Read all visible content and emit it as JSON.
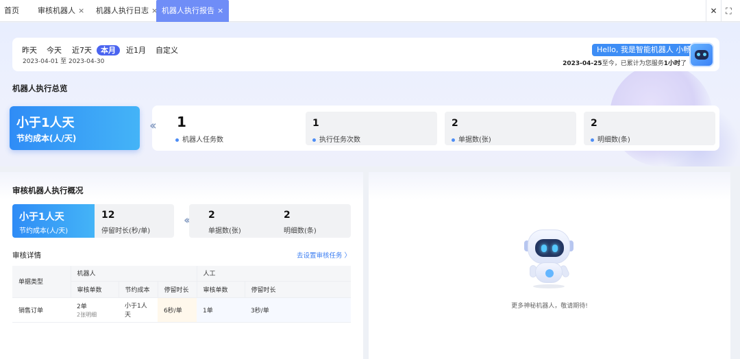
{
  "tabs": [
    {
      "label": "首页",
      "closable": false,
      "active": false
    },
    {
      "label": "审核机器人",
      "closable": true,
      "active": false
    },
    {
      "label": "机器人执行日志",
      "closable": true,
      "active": false
    },
    {
      "label": "机器人执行报告",
      "closable": true,
      "active": true
    }
  ],
  "tab_close_glyph": "×",
  "window_controls": {
    "close": "✕",
    "fullscreen": "⛶"
  },
  "date_filter": {
    "options": [
      "昨天",
      "今天",
      "近7天",
      "本月",
      "近1月",
      "自定义"
    ],
    "selected": "本月",
    "range": "2023-04-01 至 2023-04-30"
  },
  "assistant": {
    "greeting": "Hello, 我是智能机器人 小畅",
    "service_date": "2023-04-25",
    "service_mid": "至今，已累计为您服务",
    "service_hours": "1小时",
    "service_end": "了"
  },
  "overview": {
    "title": "机器人执行总览",
    "saving_value": "小于1人天",
    "saving_label": "节约成本(人/天)",
    "stats": [
      {
        "value": "1",
        "label": "机器人任务数"
      },
      {
        "value": "1",
        "label": "执行任务次数"
      },
      {
        "value": "2",
        "label": "单据数(张)"
      },
      {
        "value": "2",
        "label": "明细数(条)"
      }
    ]
  },
  "audit": {
    "title": "审核机器人执行概况",
    "saving_value": "小于1人天",
    "saving_label": "节约成本(人/天)",
    "stay_value": "12",
    "stay_label": "停留时长(秒/单)",
    "docs_value": "2",
    "docs_label": "单据数(张)",
    "details_value": "2",
    "details_label": "明细数(条)",
    "detail_title": "审核详情",
    "setup_link": "去设置审核任务 〉",
    "table": {
      "col_type": "单据类型",
      "group_robot": "机器人",
      "group_manual": "人工",
      "sub_headers": [
        "审核单数",
        "节约成本",
        "停留时长",
        "审核单数",
        "停留时长"
      ],
      "rows": [
        {
          "type": "销售订单",
          "robot_count": "2单",
          "robot_count_sub": "2张明细",
          "robot_saving": "小于1人天",
          "robot_stay": "6秒/单",
          "manual_count": "1单",
          "manual_stay": "3秒/单"
        }
      ]
    }
  },
  "coming_soon": {
    "tip": "更多神秘机器人，敬请期待!"
  },
  "colors": {
    "accent": "#4a64f0",
    "tab_active": "#6f8df7",
    "card_blue": "#2f8cf6",
    "link": "#3d7ff2"
  }
}
